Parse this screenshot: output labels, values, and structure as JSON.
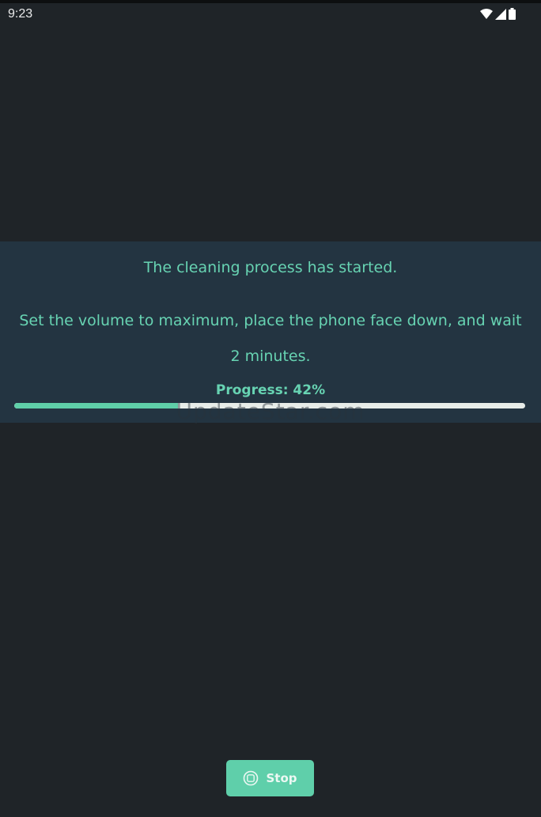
{
  "status_bar": {
    "time": "9:23",
    "icons": [
      "wifi-icon",
      "cellular-signal-icon",
      "battery-icon"
    ]
  },
  "cleaning": {
    "title": "The cleaning process has started.",
    "instructions": "Set the volume to maximum, place the phone face down, and wait 2 minutes.",
    "progress_label": "Progress: 42%",
    "progress_fraction": 0.32
  },
  "watermark": "UpdateStar.com",
  "stop_button": {
    "label": "Stop",
    "icon": "stop-circle-icon"
  },
  "colors": {
    "background": "#1f2428",
    "panel": "#233441",
    "accent": "#67d3b2",
    "progress_track": "#e7ece8"
  }
}
